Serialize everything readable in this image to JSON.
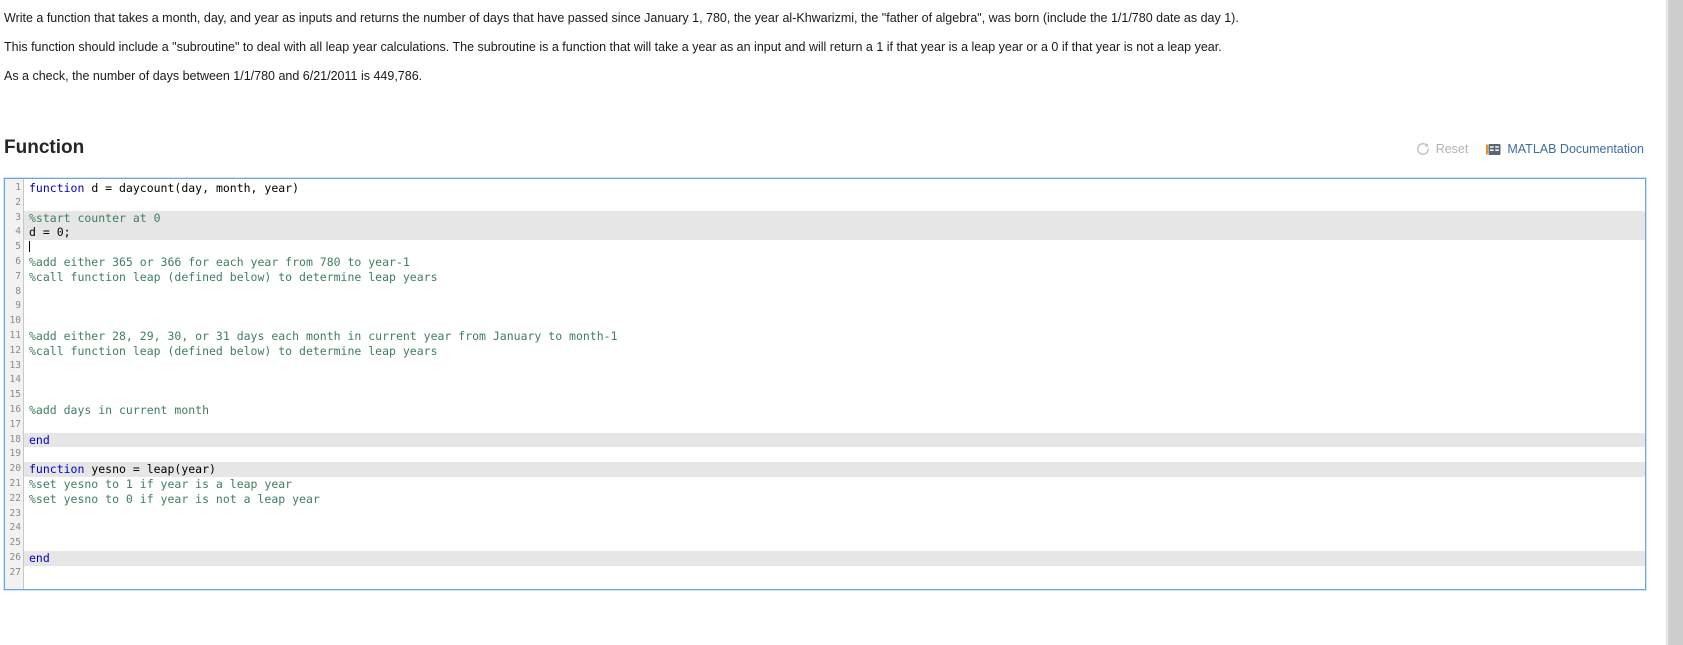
{
  "prompt": {
    "paragraphs": [
      "Write a function that takes a month, day, and year as inputs and returns the number of days that have passed since January 1, 780, the year al-Khwarizmi, the \"father of algebra\", was born (include the 1/1/780 date as day 1).",
      "This function should include a \"subroutine\" to deal with all leap year calculations. The subroutine is a function that will take a year as an input and will return a 1 if that year is a leap year or a 0 if that year is not a leap year.",
      "As a check, the number of days between 1/1/780 and 6/21/2011 is 449,786."
    ]
  },
  "section": {
    "title": "Function",
    "reset_label": "Reset",
    "reset_icon": "refresh-icon",
    "docs_label": "MATLAB Documentation",
    "docs_icon": "documentation-icon",
    "reset_color": "#b3b3b3",
    "docs_color": "#3c6ea5"
  },
  "editor": {
    "focus_border_color": "#6ba7dd",
    "highlight_color": "#e6e6e6",
    "keyword_color": "#0000c8",
    "comment_color": "#3f7f5f",
    "gutter_color": "#f2f2f2",
    "total_lines": 27,
    "cursor_line": 5,
    "lines": [
      {
        "n": 1,
        "hl": false,
        "parts": [
          {
            "t": "function",
            "c": "kw"
          },
          {
            "t": " d = daycount(day, month, year)",
            "c": ""
          }
        ]
      },
      {
        "n": 2,
        "hl": false,
        "parts": []
      },
      {
        "n": 3,
        "hl": true,
        "parts": [
          {
            "t": "%start counter at 0",
            "c": "com"
          }
        ]
      },
      {
        "n": 4,
        "hl": true,
        "parts": [
          {
            "t": "d = 0;",
            "c": ""
          }
        ]
      },
      {
        "n": 5,
        "hl": false,
        "parts": [],
        "caret": true
      },
      {
        "n": 6,
        "hl": false,
        "parts": [
          {
            "t": "%add either 365 or 366 for each year from 780 to year-1",
            "c": "com"
          }
        ]
      },
      {
        "n": 7,
        "hl": false,
        "parts": [
          {
            "t": "%call function leap (defined below) to determine leap years",
            "c": "com"
          }
        ]
      },
      {
        "n": 8,
        "hl": false,
        "parts": []
      },
      {
        "n": 9,
        "hl": false,
        "parts": []
      },
      {
        "n": 10,
        "hl": false,
        "parts": []
      },
      {
        "n": 11,
        "hl": false,
        "parts": [
          {
            "t": "%add either 28, 29, 30, or 31 days each month in current year from January to month-1",
            "c": "com"
          }
        ]
      },
      {
        "n": 12,
        "hl": false,
        "parts": [
          {
            "t": "%call function leap (defined below) to determine leap years",
            "c": "com"
          }
        ]
      },
      {
        "n": 13,
        "hl": false,
        "parts": []
      },
      {
        "n": 14,
        "hl": false,
        "parts": []
      },
      {
        "n": 15,
        "hl": false,
        "parts": []
      },
      {
        "n": 16,
        "hl": false,
        "parts": [
          {
            "t": "%add days in current month",
            "c": "com"
          }
        ]
      },
      {
        "n": 17,
        "hl": false,
        "parts": []
      },
      {
        "n": 18,
        "hl": true,
        "parts": [
          {
            "t": "end",
            "c": "kw"
          }
        ]
      },
      {
        "n": 19,
        "hl": false,
        "parts": []
      },
      {
        "n": 20,
        "hl": true,
        "parts": [
          {
            "t": "function",
            "c": "kw"
          },
          {
            "t": " yesno = leap(year)",
            "c": ""
          }
        ]
      },
      {
        "n": 21,
        "hl": false,
        "parts": [
          {
            "t": "%set yesno to 1 if year is a leap year",
            "c": "com"
          }
        ]
      },
      {
        "n": 22,
        "hl": false,
        "parts": [
          {
            "t": "%set yesno to 0 if year is not a leap year",
            "c": "com"
          }
        ]
      },
      {
        "n": 23,
        "hl": false,
        "parts": []
      },
      {
        "n": 24,
        "hl": false,
        "parts": []
      },
      {
        "n": 25,
        "hl": false,
        "parts": []
      },
      {
        "n": 26,
        "hl": true,
        "parts": [
          {
            "t": "end",
            "c": "kw"
          }
        ]
      },
      {
        "n": 27,
        "hl": false,
        "parts": []
      }
    ]
  }
}
